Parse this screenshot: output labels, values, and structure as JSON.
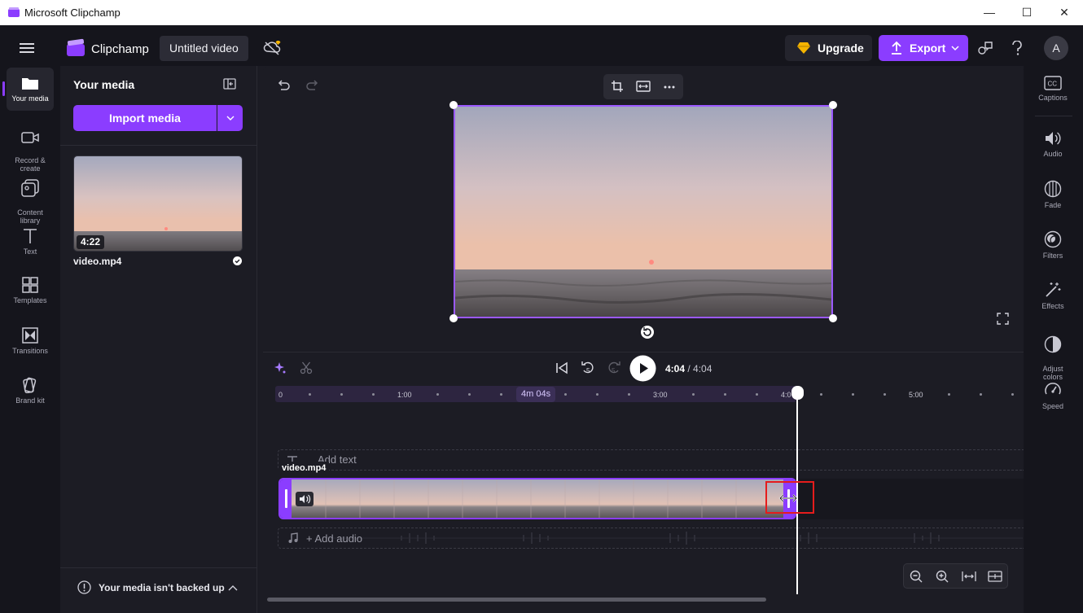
{
  "window": {
    "title": "Microsoft Clipchamp",
    "minimize": "—",
    "maximize": "☐",
    "close": "✕"
  },
  "header": {
    "app_name": "Clipchamp",
    "project_name": "Untitled video",
    "upgrade_label": "Upgrade",
    "export_label": "Export",
    "avatar_initial": "A"
  },
  "left_rail": {
    "items": [
      {
        "label": "Your media",
        "icon": "folder-icon"
      },
      {
        "label": "Record &\ncreate",
        "icon": "camera-icon"
      },
      {
        "label": "Content\nlibrary",
        "icon": "library-icon"
      },
      {
        "label": "Text",
        "icon": "text-icon"
      },
      {
        "label": "Templates",
        "icon": "templates-icon"
      },
      {
        "label": "Transitions",
        "icon": "transitions-icon"
      },
      {
        "label": "Brand kit",
        "icon": "brand-kit-icon"
      }
    ]
  },
  "media_panel": {
    "title": "Your media",
    "import_label": "Import media",
    "items": [
      {
        "name": "video.mp4",
        "duration": "4:22"
      }
    ],
    "backup_text": "Your media isn't backed up"
  },
  "player": {
    "current_time": "4:04",
    "separator": " / ",
    "total_time": "4:04"
  },
  "timeline": {
    "ruler_labels": [
      "0",
      "1:00",
      "3:00",
      "4:0",
      "5:00"
    ],
    "duration_badge": "4m 04s",
    "text_track": "Add text",
    "clip_name": "video.mp4",
    "audio_track": "+ Add audio"
  },
  "right_rail": {
    "items": [
      {
        "label": "Captions",
        "icon": "captions-icon"
      },
      {
        "label": "Audio",
        "icon": "speaker-icon"
      },
      {
        "label": "Fade",
        "icon": "fade-icon"
      },
      {
        "label": "Filters",
        "icon": "filters-icon"
      },
      {
        "label": "Effects",
        "icon": "magic-wand-icon"
      },
      {
        "label": "Adjust\ncolors",
        "icon": "adjust-colors-icon"
      },
      {
        "label": "Speed",
        "icon": "speedometer-icon"
      }
    ]
  },
  "colors": {
    "accent": "#8b3dff",
    "background": "#1c1c24",
    "highlight": "#e51c1c"
  }
}
